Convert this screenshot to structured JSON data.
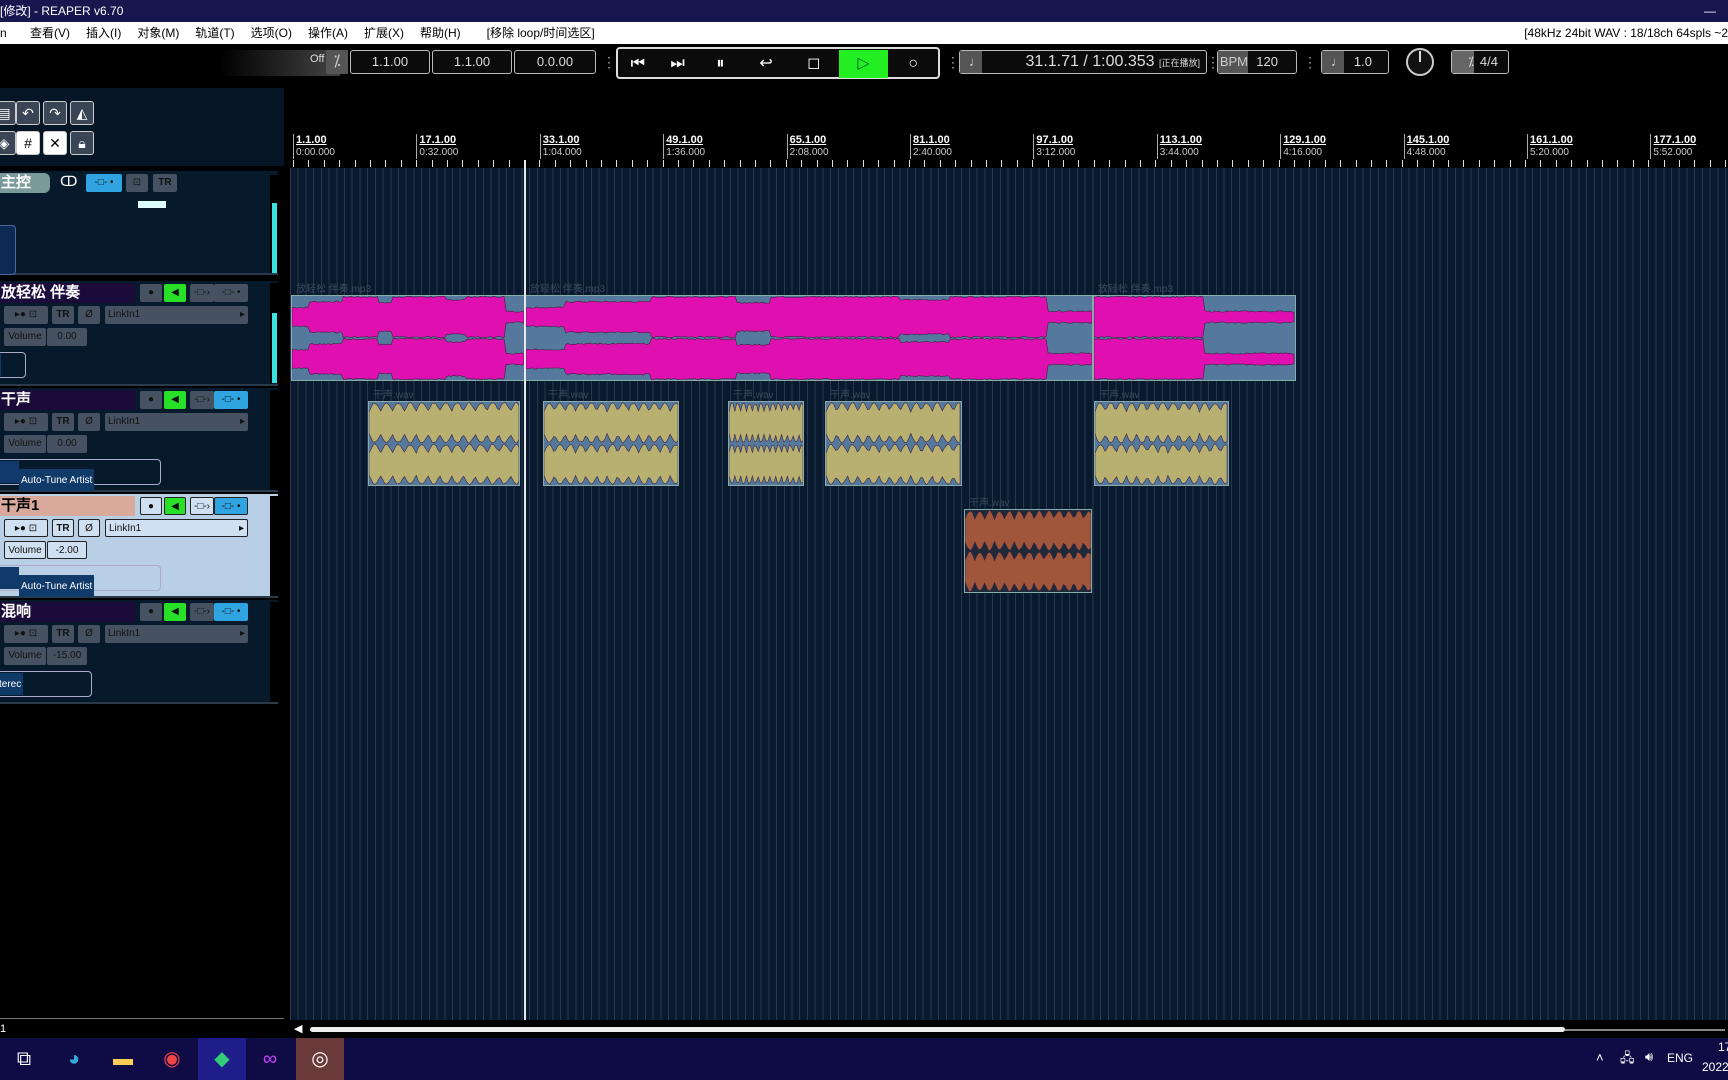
{
  "window": {
    "title": "[修改] - REAPER v6.70"
  },
  "menu": {
    "items": [
      "查看(V)",
      "插入(I)",
      "对象(M)",
      "轨道(T)",
      "选项(O)",
      "操作(A)",
      "扩展(X)",
      "帮助(H)",
      "[移除 loop/时间选区]"
    ],
    "audio_status": "[48kHz 24bit WAV : 18/18ch 64spls ~2"
  },
  "toolbar": {
    "grid_knob": "Off",
    "sel_start": "1.1.00",
    "sel_end": "1.1.00",
    "sel_len": "0.0.00",
    "position": "31.1.71 / 1:00.353",
    "play_state": "[正在播放]",
    "bpm_label": "BPM",
    "bpm": "120",
    "rate": "1.0",
    "timesig": "4/4",
    "play_color": "#22ee22"
  },
  "ruler": {
    "marks": [
      [
        "1.1.00",
        "0:00.000"
      ],
      [
        "17.1.00",
        "0:32.000"
      ],
      [
        "33.1.00",
        "1:04.000"
      ],
      [
        "49.1.00",
        "1:36.000"
      ],
      [
        "65.1.00",
        "2:08.000"
      ],
      [
        "81.1.00",
        "2:40.000"
      ],
      [
        "97.1.00",
        "3:12.000"
      ],
      [
        "113.1.00",
        "3:44.000"
      ],
      [
        "129.1.00",
        "4:16.000"
      ],
      [
        "145.1.00",
        "4:48.000"
      ],
      [
        "161.1.00",
        "5:20.000"
      ],
      [
        "177.1.00",
        "5:52.000"
      ]
    ]
  },
  "tracks": [
    {
      "name": "主控",
      "type": "master"
    },
    {
      "name": "放轻松 伴奏",
      "input": "LinkIn1",
      "vol_label": "Volume",
      "volume": "0.00",
      "fx": ""
    },
    {
      "name": "干声",
      "input": "LinkIn1",
      "vol_label": "Volume",
      "volume": "0.00",
      "fx": "Auto-Tune Artist"
    },
    {
      "name": "干声1",
      "input": "LinkIn1",
      "vol_label": "Volume",
      "volume": "-2.00",
      "fx": "Auto-Tune Artist",
      "selected": true
    },
    {
      "name": "混响",
      "input": "LinkIn1",
      "vol_label": "Volume",
      "volume": "-15.00",
      "fx": "terec"
    }
  ],
  "items": {
    "backing_label": "放轻松 伴奏.mp3",
    "vocal_label": "干声.wav",
    "colors": {
      "backing": "#e010b0",
      "vocal": "#b8b070",
      "vocal1": "#a0563a"
    }
  },
  "tray": {
    "lang": "ENG",
    "clock": "17",
    "date": "2022"
  }
}
